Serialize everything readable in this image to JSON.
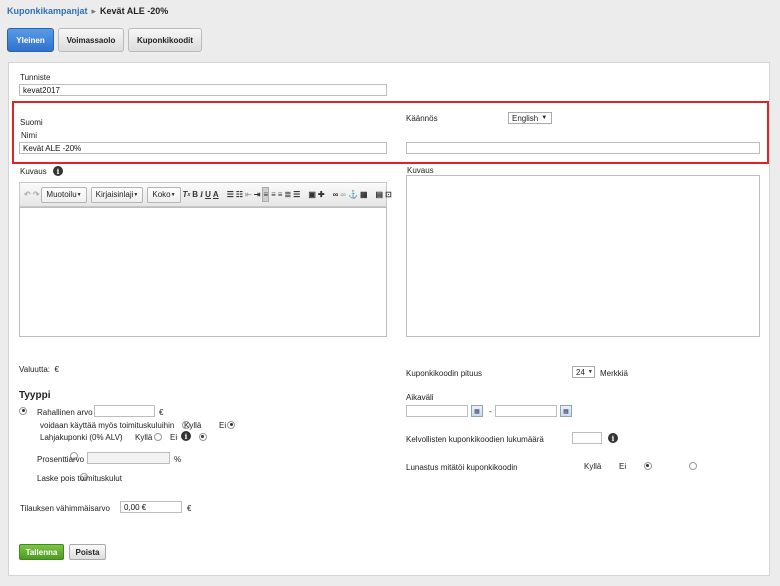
{
  "breadcrumb": {
    "parent": "Kuponkikampanjat",
    "separator": "▸",
    "current": "Kevät ALE -20%"
  },
  "tabs": [
    {
      "label": "Yleinen",
      "active": true
    },
    {
      "label": "Voimassaolo",
      "active": false
    },
    {
      "label": "Kuponkikoodit",
      "active": false
    }
  ],
  "form": {
    "tunniste": {
      "label": "Tunniste",
      "value": "kevat2017"
    },
    "language": {
      "source_label": "Suomi",
      "translation_label": "Käännös",
      "translation_selected": "English"
    },
    "nimi": {
      "label": "Nimi",
      "value": "Kevät ALE -20%",
      "translation_value": ""
    },
    "kuvaus": {
      "label": "Kuvaus",
      "translation_label": "Kuvaus"
    },
    "editor_toolbar": {
      "format": "Muotoilu",
      "font": "Kirjaisinlaji",
      "size": "Koko"
    },
    "currency": {
      "label": "Valuutta:",
      "value": "€"
    },
    "type": {
      "heading": "Tyyppi",
      "fixed": {
        "label": "Rahallinen arvo",
        "value": "",
        "unit": "€"
      },
      "shipping": {
        "label": "voidaan käyttää myös toimituskuluihin",
        "yes": "Kyllä",
        "no": "Ei"
      },
      "gift": {
        "label": "Lahjakuponki (0% ALV)",
        "yes": "Kyllä",
        "no": "Ei"
      },
      "percent": {
        "label": "Prosenttiarvo",
        "value": "",
        "unit": "%"
      },
      "free_shipping": {
        "label": "Laske pois toimituskulut"
      }
    },
    "min_order": {
      "label": "Tilauksen vähimmäisarvo",
      "value": "0,00 €",
      "unit": "€"
    },
    "code_length": {
      "label": "Kuponkikoodin pituus",
      "value": "24",
      "unit": "Merkkiä"
    },
    "interval": {
      "label": "Aikaväli",
      "start": "",
      "end": "",
      "dash": "-"
    },
    "valid_codes": {
      "label": "Kelvollisten kuponkikoodien lukumäärä",
      "value": ""
    },
    "redeem": {
      "label": "Lunastus mitätöi kuponkikoodin",
      "yes": "Kyllä",
      "no": "Ei"
    }
  },
  "buttons": {
    "save": "Tallenna",
    "delete": "Poista"
  },
  "colors": {
    "accent": "#2f72cc",
    "highlight": "#e02424",
    "save": "#4e9a24"
  }
}
